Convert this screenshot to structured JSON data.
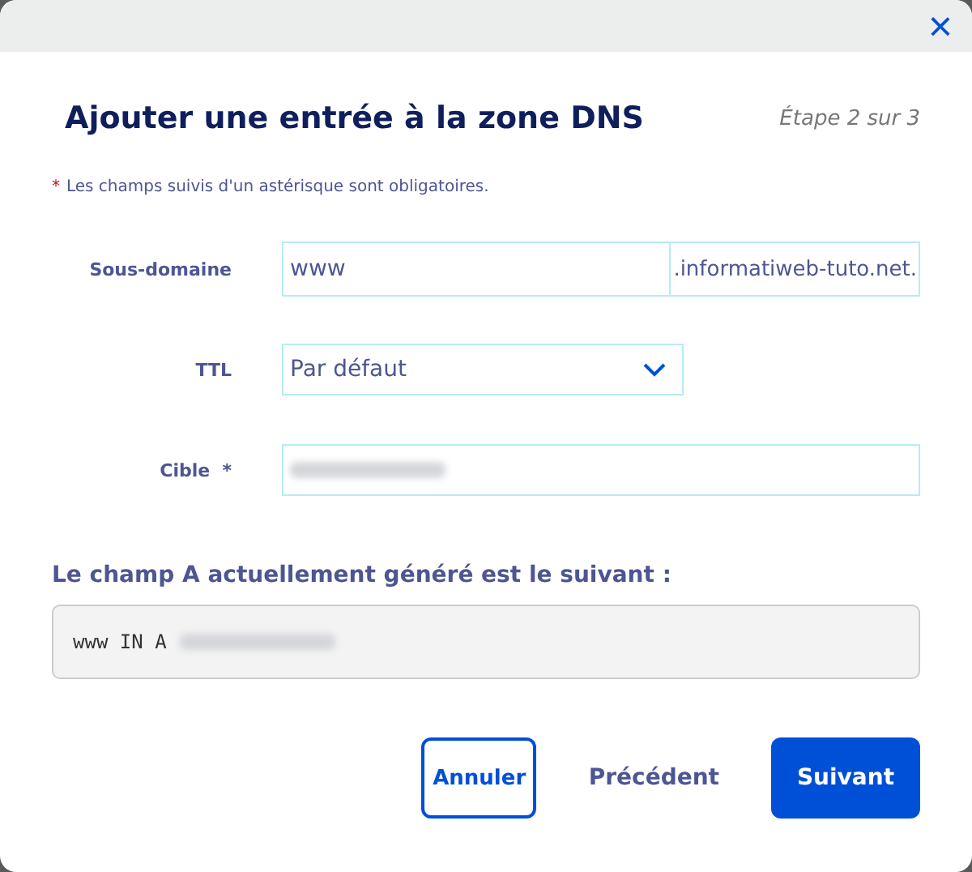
{
  "dialog": {
    "close": "×",
    "title": "Ajouter une entrée à la zone DNS",
    "step": "Étape 2 sur 3"
  },
  "required_note": {
    "mark": "*",
    "text": "Les champs suivis d'un astérisque sont obligatoires."
  },
  "fields": [
    {
      "kind": "suffixed",
      "label": "Sous-domaine",
      "value": "www",
      "suffix": ".informatiweb-tuto.net."
    },
    {
      "kind": "select",
      "label": "TTL",
      "value": "Par défaut"
    },
    {
      "kind": "redacted",
      "label": "Cible  *"
    }
  ],
  "generated": {
    "heading": "Le champ A actuellement généré est le suivant :",
    "record": "www IN A",
    "redacted": true
  },
  "buttons": [
    {
      "kind": "outline",
      "label": "Annuler"
    },
    {
      "kind": "text",
      "label": "Précédent"
    },
    {
      "kind": "primary",
      "label": "Suivant"
    }
  ]
}
